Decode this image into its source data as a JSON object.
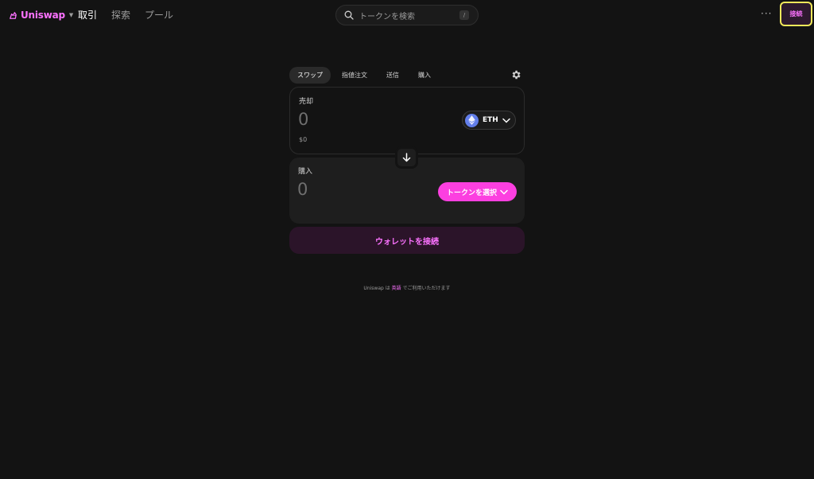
{
  "header": {
    "logo_text": "Uniswap",
    "nav": [
      "取引",
      "探索",
      "プール"
    ],
    "search_placeholder": "トークンを検索",
    "search_shortcut": "/",
    "more_label": "···",
    "connect_label": "接続"
  },
  "swap": {
    "tabs": [
      "スワップ",
      "指値注文",
      "送信",
      "購入"
    ],
    "active_tab": "スワップ",
    "sell": {
      "label": "売却",
      "amount": "0",
      "usd_value": "$0",
      "token": "ETH",
      "token_icon": "ethereum-icon"
    },
    "buy": {
      "label": "購入",
      "amount": "0",
      "select_label": "トークンを選択"
    },
    "wallet_button": "ウォレットを接続"
  },
  "footer": {
    "prefix": "Uniswap は ",
    "link": "英語",
    "suffix": " でご利用いただけます"
  },
  "colors": {
    "background": "#131313",
    "accent": "#fc72ff",
    "accent_button": "#fc3fe0",
    "highlight_border": "#f2e85a",
    "eth": "#627eea"
  }
}
